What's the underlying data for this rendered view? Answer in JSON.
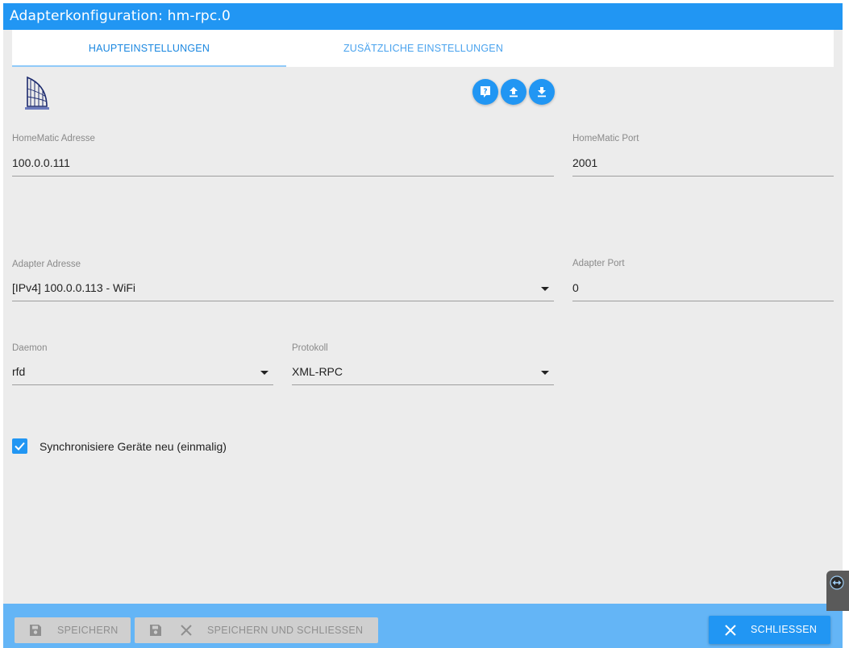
{
  "window": {
    "title": "Adapterkonfiguration: hm-rpc.0"
  },
  "tabs": [
    {
      "label": "HAUPTEINSTELLUNGEN",
      "active": true
    },
    {
      "label": "ZUSÄTZLICHE EINSTELLUNGEN",
      "active": false
    }
  ],
  "toolbar": {
    "icons": [
      "help-icon",
      "upload-icon",
      "download-icon"
    ]
  },
  "fields": {
    "homematic_address": {
      "label": "HomeMatic Adresse",
      "value": "100.0.0.111"
    },
    "homematic_port": {
      "label": "HomeMatic Port",
      "value": "2001"
    },
    "adapter_address": {
      "label": "Adapter Adresse",
      "value": "[IPv4] 100.0.0.113 - WiFi"
    },
    "adapter_port": {
      "label": "Adapter Port",
      "value": "0"
    },
    "daemon": {
      "label": "Daemon",
      "value": "rfd"
    },
    "protocol": {
      "label": "Protokoll",
      "value": "XML-RPC"
    }
  },
  "checkbox": {
    "label": "Synchronisiere Geräte neu (einmalig)",
    "checked": true
  },
  "footer": {
    "save_label": "SPEICHERN",
    "save_close_label": "SPEICHERN UND SCHLIESSEN",
    "close_label": "SCHLIESSEN"
  },
  "colors": {
    "accent": "#2196f3",
    "footer_bg": "#64b5f6",
    "panel_bg": "#ececec",
    "disabled_btn": "#cfcfcf"
  }
}
